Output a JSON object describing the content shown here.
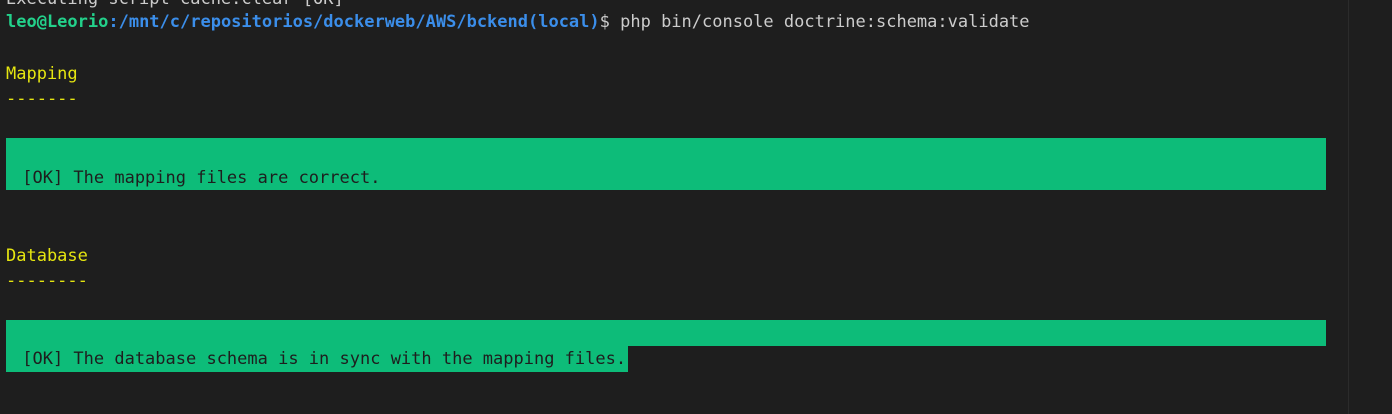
{
  "terminal": {
    "clipped_line": "Executing script cache:clear [OK]",
    "prompt": {
      "user_host": "leo@Leorio",
      "path": ":/mnt/c/repositorios/dockerweb/AWS/bckend(local)",
      "symbol": "$",
      "command": " php bin/console doctrine:schema:validate"
    },
    "sections": [
      {
        "title": "Mapping",
        "underline": "-------",
        "ok_message": " [OK] The mapping files are correct."
      },
      {
        "title": "Database",
        "underline": "--------",
        "ok_message": " [OK] The database schema is in sync with the mapping files."
      }
    ]
  },
  "colors": {
    "background": "#1e1e1e",
    "user": "#23d18b",
    "path": "#3b8eea",
    "heading": "#e5e510",
    "ok_bg": "#0dbc79",
    "text": "#cccccc"
  }
}
